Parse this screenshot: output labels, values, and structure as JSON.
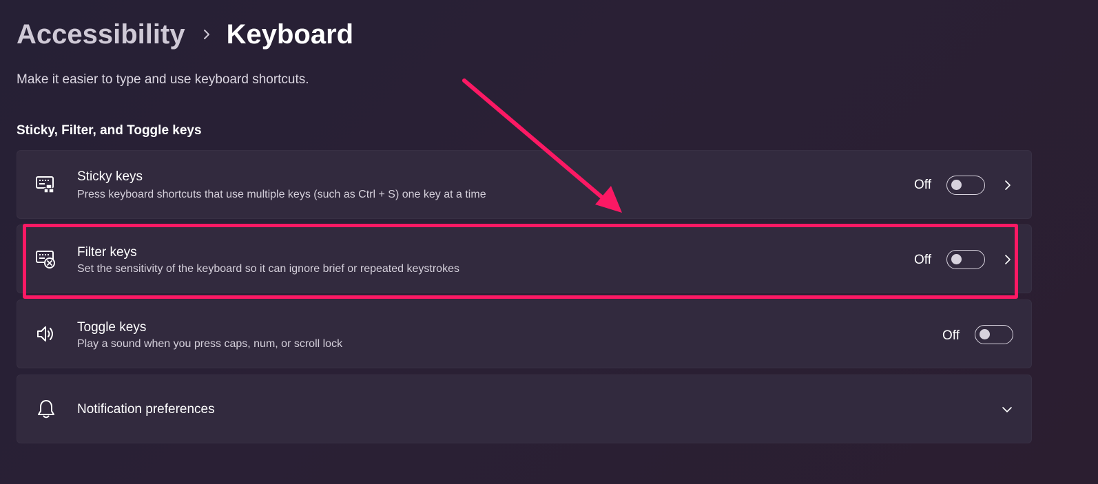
{
  "breadcrumb": {
    "parent": "Accessibility",
    "current": "Keyboard"
  },
  "page": {
    "description": "Make it easier to type and use keyboard shortcuts."
  },
  "section": {
    "title": "Sticky, Filter, and Toggle keys"
  },
  "settings": {
    "sticky_keys": {
      "title": "Sticky keys",
      "description": "Press keyboard shortcuts that use multiple keys (such as Ctrl + S) one key at a time",
      "state": "Off",
      "icon": "sticky-keys-keyboard-icon"
    },
    "filter_keys": {
      "title": "Filter keys",
      "description": "Set the sensitivity of the keyboard so it can ignore brief or repeated keystrokes",
      "state": "Off",
      "icon": "filter-keys-keyboard-icon"
    },
    "toggle_keys": {
      "title": "Toggle keys",
      "description": "Play a sound when you press caps, num, or scroll lock",
      "state": "Off",
      "icon": "speaker-icon"
    },
    "notifications": {
      "title": "Notification preferences",
      "icon": "bell-icon"
    }
  },
  "annotation": {
    "color": "#fb1964"
  },
  "colors": {
    "card_background": "#322a3e",
    "page_background": "#272034"
  }
}
